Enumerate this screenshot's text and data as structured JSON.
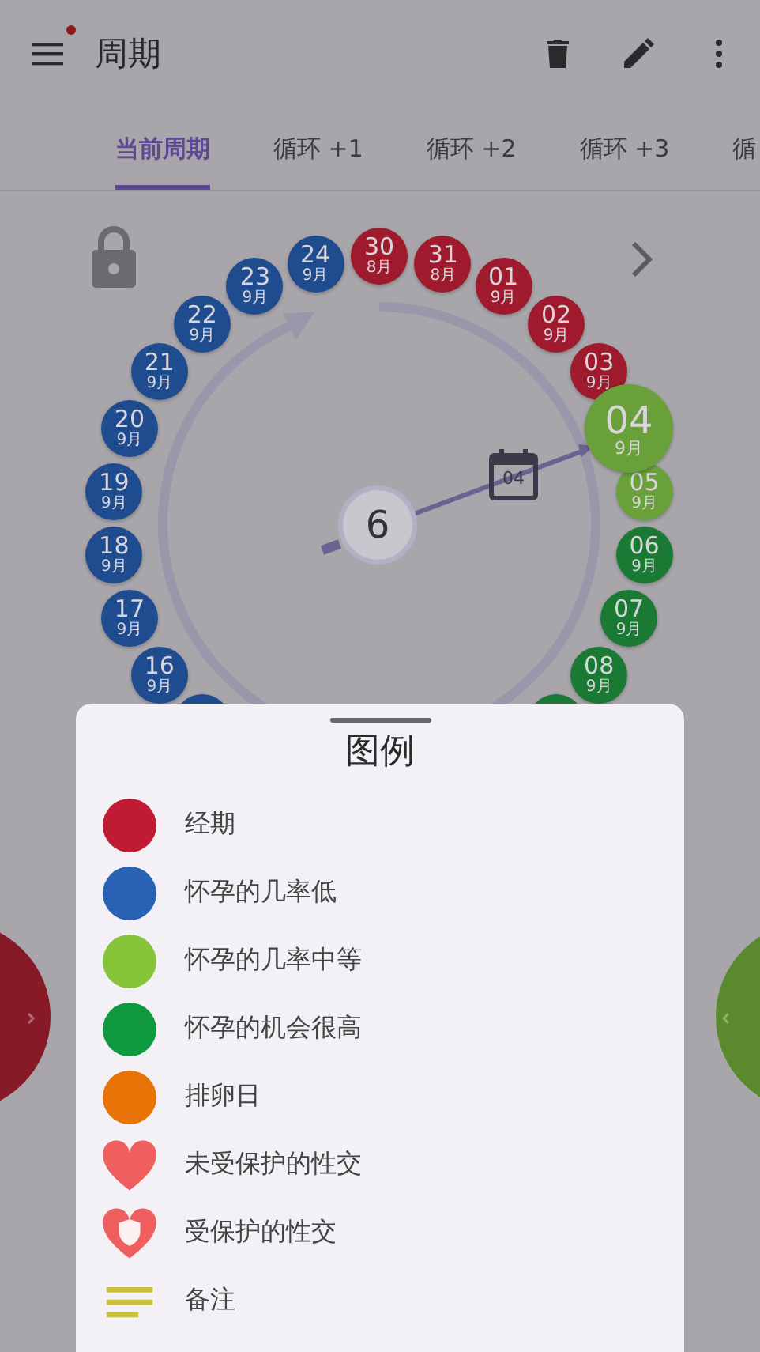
{
  "app_bar": {
    "title": "周期",
    "has_notification": true
  },
  "tabs": [
    {
      "label": "当前周期",
      "selected": true
    },
    {
      "label": "循环 +1",
      "selected": false
    },
    {
      "label": "循环 +2",
      "selected": false
    },
    {
      "label": "循环 +3",
      "selected": false
    },
    {
      "label": "循",
      "selected": false
    }
  ],
  "wheel": {
    "locked": true,
    "cycle_day": "6",
    "calendar_day": "04",
    "days_clockwise": [
      {
        "day": "30",
        "month": "8月",
        "color": "#9e1a2c",
        "selected": false
      },
      {
        "day": "31",
        "month": "8月",
        "color": "#9e1a2c",
        "selected": false
      },
      {
        "day": "01",
        "month": "9月",
        "color": "#9e1a2c",
        "selected": false
      },
      {
        "day": "02",
        "month": "9月",
        "color": "#9e1a2c",
        "selected": false
      },
      {
        "day": "03",
        "month": "9月",
        "color": "#9e1a2c",
        "selected": false
      },
      {
        "day": "04",
        "month": "9月",
        "color": "#6aa03a",
        "selected": true
      },
      {
        "day": "05",
        "month": "9月",
        "color": "#6aa03a",
        "selected": false
      },
      {
        "day": "06",
        "month": "9月",
        "color": "#1a7a34",
        "selected": false
      },
      {
        "day": "07",
        "month": "9月",
        "color": "#1a7a34",
        "selected": false
      },
      {
        "day": "08",
        "month": "9月",
        "color": "#1a7a34",
        "selected": false
      },
      {
        "color": "#1a7a34",
        "selected": false
      }
    ],
    "days_counterclockwise": [
      {
        "day": "24",
        "month": "9月",
        "color": "#1f4c8f",
        "selected": false
      },
      {
        "day": "23",
        "month": "9月",
        "color": "#1f4c8f",
        "selected": false
      },
      {
        "day": "22",
        "month": "9月",
        "color": "#1f4c8f",
        "selected": false
      },
      {
        "day": "21",
        "month": "9月",
        "color": "#1f4c8f",
        "selected": false
      },
      {
        "day": "20",
        "month": "9月",
        "color": "#1f4c8f",
        "selected": false
      },
      {
        "day": "19",
        "month": "9月",
        "color": "#1f4c8f",
        "selected": false
      },
      {
        "day": "18",
        "month": "9月",
        "color": "#1f4c8f",
        "selected": false
      },
      {
        "day": "17",
        "month": "9月",
        "color": "#1f4c8f",
        "selected": false
      },
      {
        "day": "16",
        "month": "9月",
        "color": "#1f4c8f",
        "selected": false
      },
      {
        "color": "#1f4c8f",
        "selected": false
      }
    ]
  },
  "legend": {
    "title": "图例",
    "items": [
      {
        "kind": "dot",
        "color": "#c01a35",
        "label": "经期"
      },
      {
        "kind": "dot",
        "color": "#2a62b5",
        "label": "怀孕的几率低"
      },
      {
        "kind": "dot",
        "color": "#86c43a",
        "label": "怀孕的几率中等"
      },
      {
        "kind": "dot",
        "color": "#0f9a40",
        "label": "怀孕的机会很高"
      },
      {
        "kind": "dot",
        "color": "#e87408",
        "label": "排卵日"
      },
      {
        "kind": "heart",
        "label": "未受保护的性交"
      },
      {
        "kind": "shield-heart",
        "label": "受保护的性交"
      },
      {
        "kind": "note",
        "label": "备注"
      }
    ]
  }
}
